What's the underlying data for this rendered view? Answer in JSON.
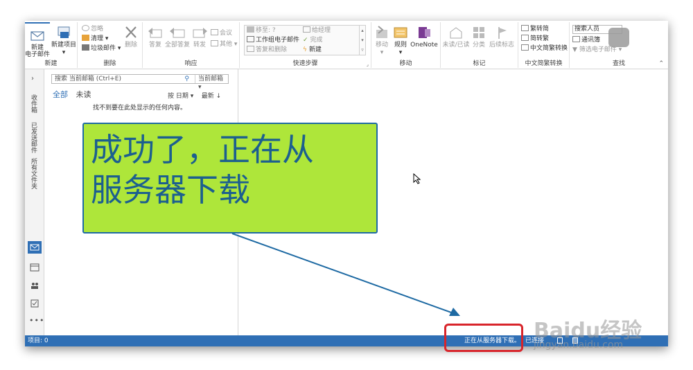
{
  "ribbon": {
    "new_group": {
      "label": "新建",
      "new_email_line1": "新建",
      "new_email_line2": "电子邮件",
      "new_items": "新建项目"
    },
    "delete_group": {
      "label": "删除",
      "ignore": "忽略",
      "cleanup": "清理",
      "junk": "垃圾邮件",
      "delete": "删除"
    },
    "respond_group": {
      "label": "响应",
      "reply": "答复",
      "reply_all": "全部答复",
      "forward": "转发",
      "meeting": "会议",
      "more": "其他"
    },
    "quick_steps_group": {
      "label": "快速步骤",
      "items": [
        "移至: ?",
        "工作组电子邮件",
        "答复和删除",
        "给经理",
        "完成",
        "新建"
      ]
    },
    "move_group": {
      "label": "移动",
      "move": "移动",
      "rules": "规则",
      "onenote": "OneNote"
    },
    "tags_group": {
      "label": "标记",
      "unread_read": "未读/已读",
      "categorize": "分类",
      "follow_up": "后续标志"
    },
    "chinese_group": {
      "label": "中文简繁转换",
      "to_simplified": "繁转简",
      "to_traditional": "简转繁",
      "convert": "中文简繁转换"
    },
    "find_group": {
      "label": "查找",
      "search_people": "搜索人员",
      "address_book": "通讯簿",
      "filter_email": "筛选电子邮件"
    }
  },
  "nav": {
    "expand": "›",
    "folders": [
      "收件箱",
      "已发送邮件",
      "所有文件夹"
    ]
  },
  "list": {
    "search_placeholder": "搜索 当前邮箱 (Ctrl+E)",
    "search_scope": "当前邮箱",
    "tab_all": "全部",
    "tab_unread": "未读",
    "sort_by": "按 日期",
    "sort_order": "最新 ↓",
    "empty_message": "找不到要在此处显示的任何内容。"
  },
  "status": {
    "items": "项目: 0",
    "progress": "正在从服务器下载。",
    "connection": "已连接"
  },
  "annotation": {
    "callout_line1": "成功了，正在从",
    "callout_line2": "服务器下载",
    "arrow_color": "#1e6aa3",
    "callout_fill": "#aee63a",
    "highlight_color": "#d8242a"
  },
  "watermark": {
    "brand": "Baidu经验",
    "url": "jingyan.baidu.com"
  },
  "colors": {
    "accent": "#2f6fb5"
  }
}
